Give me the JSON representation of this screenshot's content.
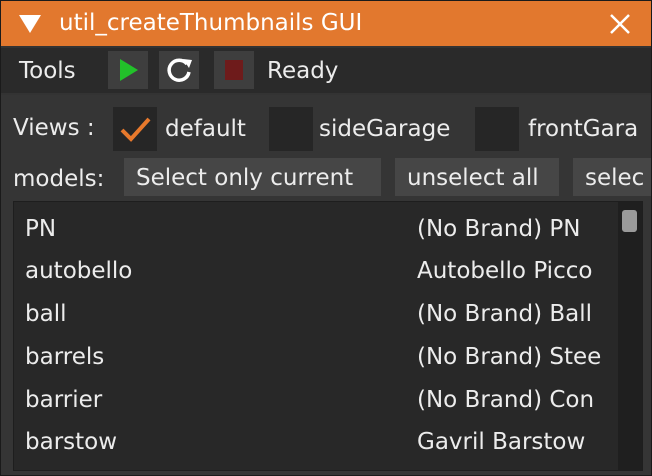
{
  "window": {
    "title": "util_createThumbnails GUI",
    "accent_color": "#e2782e"
  },
  "toolbar": {
    "label": "Tools",
    "status": "Ready",
    "play_icon_color": "#22c12a",
    "stop_icon_color": "#6e1b1b"
  },
  "views": {
    "label": "Views :",
    "options": [
      {
        "label": "default",
        "checked": true
      },
      {
        "label": "sideGarage",
        "checked": false
      },
      {
        "label": "frontGara",
        "checked": false
      }
    ]
  },
  "models": {
    "label": "models:",
    "buttons": [
      "Select only current",
      "unselect all",
      "selec"
    ]
  },
  "model_list": [
    {
      "name": "PN",
      "brand": "(No Brand) PN"
    },
    {
      "name": "autobello",
      "brand": "Autobello Picco"
    },
    {
      "name": "ball",
      "brand": "(No Brand) Ball"
    },
    {
      "name": "barrels",
      "brand": "(No Brand) Stee"
    },
    {
      "name": "barrier",
      "brand": "(No Brand) Con"
    },
    {
      "name": "barstow",
      "brand": "Gavril Barstow"
    }
  ]
}
